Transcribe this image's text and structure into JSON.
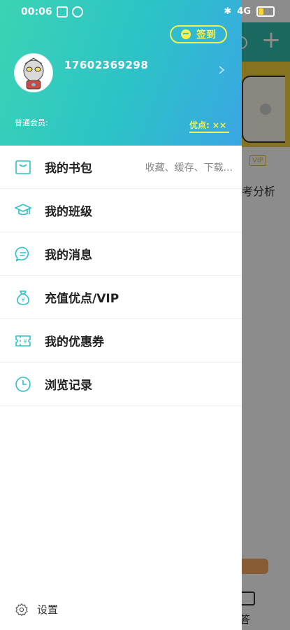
{
  "status_bar": {
    "time": "00:06",
    "network": "4G",
    "battery_fraction": 0.35,
    "battery_color": "#f5d53a"
  },
  "drawer": {
    "signin_label": "签到",
    "phone": "17602369298",
    "member_label": "普通会员:",
    "points_label": "优点: ××",
    "accent_color": "#2cc2c8",
    "highlight_color": "#f7f04e",
    "menu": [
      {
        "label": "我的书包",
        "hint": "收藏、缓存、下载...",
        "icon": "bag-icon"
      },
      {
        "label": "我的班级",
        "hint": "",
        "icon": "graduation-cap-icon"
      },
      {
        "label": "我的消息",
        "hint": "",
        "icon": "message-icon"
      },
      {
        "label": "充值优点/VIP",
        "hint": "",
        "icon": "money-bag-icon"
      },
      {
        "label": "我的优惠券",
        "hint": "",
        "icon": "coupon-icon"
      },
      {
        "label": "浏览记录",
        "hint": "",
        "icon": "clock-icon"
      }
    ],
    "settings_label": "设置"
  },
  "background": {
    "vip_badge": "VIP",
    "analysis_text": "考分析",
    "answer_text": "答"
  }
}
